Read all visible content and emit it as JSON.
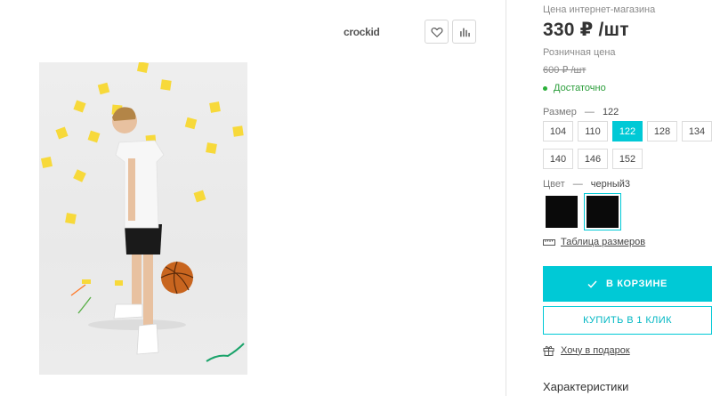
{
  "brand": {
    "name": "crockid"
  },
  "icons": {
    "favorite": "heart-icon",
    "compare": "bar-chart-icon",
    "in_stock": "green-dot",
    "size_table": "ruler-icon",
    "cart": "check-icon",
    "gift": "gift-icon"
  },
  "colors": {
    "accent": "#00c9d6",
    "in_stock": "#2bb03a",
    "swatch": "#0a0a0a"
  },
  "product": {
    "online_price_label": "Цена интернет-магазина",
    "online_price": "330 ₽ /шт",
    "retail_price_label": "Розничная цена",
    "retail_price": "600 ₽ /шт",
    "availability": "Достаточно"
  },
  "size": {
    "label": "Размер",
    "separator": "—",
    "selected": "122",
    "options": [
      "104",
      "110",
      "122",
      "128",
      "134",
      "140",
      "146",
      "152"
    ]
  },
  "color": {
    "label": "Цвет",
    "separator": "—",
    "selected": "черный3",
    "options": [
      "black",
      "black"
    ]
  },
  "actions": {
    "size_table": "Таблица размеров",
    "add_to_cart": "В КОРЗИНЕ",
    "buy_one_click": "КУПИТЬ В 1 КЛИК",
    "gift": "Хочу в подарок"
  },
  "section": {
    "characteristics": "Характеристики"
  }
}
